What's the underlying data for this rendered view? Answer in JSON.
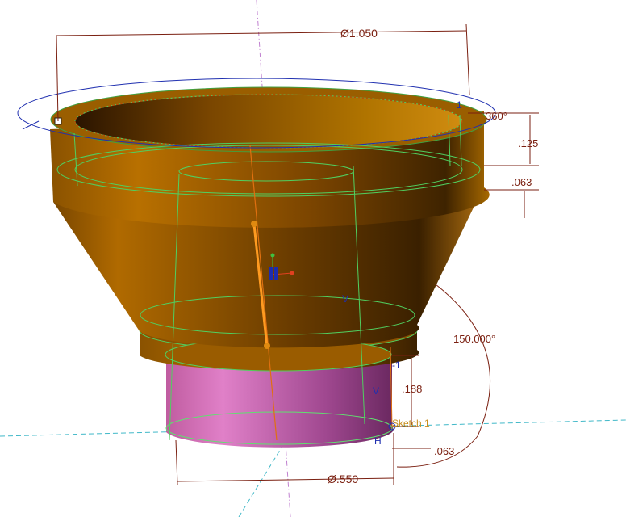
{
  "viewport": {
    "background": "#ffffff",
    "part_color": "#a86400",
    "shaft_color": "#d860b0"
  },
  "dimensions": {
    "top_diameter": "Ø1.050",
    "bottom_diameter": "Ø.550",
    "revolve_angle": "360°",
    "cone_angle": "150.000°",
    "rim_height": ".125",
    "rim_step": ".063",
    "shaft_height": ".188",
    "shaft_offset": ".063"
  },
  "constraints": {
    "vertical_1": "V",
    "vertical_2": "V",
    "horizontal": "H",
    "equal_1": "-1",
    "equal_2": "1"
  },
  "sketch": {
    "label": "Sketch 1"
  }
}
